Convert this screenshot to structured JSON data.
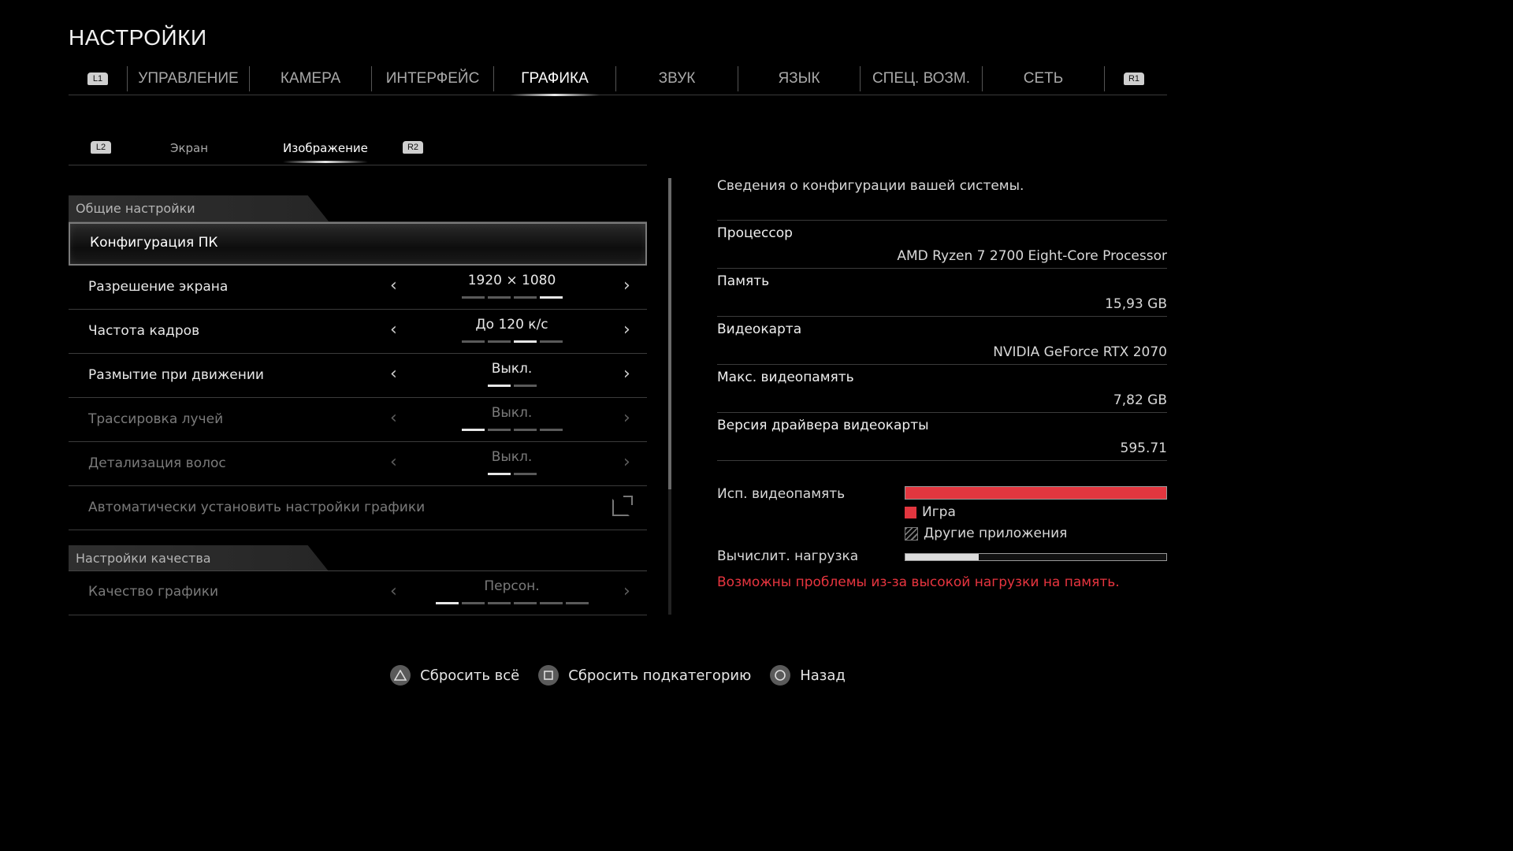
{
  "page_title": "НАСТРОЙКИ",
  "top_tabs": {
    "left_shoulder": "L1",
    "right_shoulder": "R1",
    "items": [
      {
        "label": "УПРАВЛЕНИЕ"
      },
      {
        "label": "КАМЕРА"
      },
      {
        "label": "ИНТЕРФЕЙС"
      },
      {
        "label": "ГРАФИКА",
        "active": true
      },
      {
        "label": "ЗВУК"
      },
      {
        "label": "ЯЗЫК"
      },
      {
        "label": "СПЕЦ. ВОЗМ."
      },
      {
        "label": "СЕТЬ"
      }
    ]
  },
  "sub_tabs": {
    "left_trigger": "L2",
    "right_trigger": "R2",
    "items": [
      {
        "label": "Экран"
      },
      {
        "label": "Изображение",
        "active": true
      }
    ]
  },
  "sections": {
    "general": "Общие настройки",
    "quality": "Настройки качества"
  },
  "rows": {
    "pc_config": {
      "label": "Конфигурация ПК"
    },
    "resolution": {
      "label": "Разрешение экрана",
      "value": "1920 × 1080",
      "level": 4,
      "levels": 4
    },
    "framerate": {
      "label": "Частота кадров",
      "value": "До 120 к/с",
      "level": 3,
      "levels": 4
    },
    "motion_blur": {
      "label": "Размытие при движении",
      "value": "Выкл.",
      "level": 1,
      "levels": 2
    },
    "ray_tracing": {
      "label": "Трассировка лучей",
      "value": "Выкл.",
      "level": 1,
      "levels": 4
    },
    "hair_detail": {
      "label": "Детализация волос",
      "value": "Выкл.",
      "level": 1,
      "levels": 2
    },
    "auto_settings": {
      "label": "Автоматически установить настройки графики"
    },
    "graphics_quality": {
      "label": "Качество графики",
      "value": "Персон.",
      "level": 1,
      "levels": 6
    }
  },
  "arrows": {
    "left": "‹",
    "right": "›"
  },
  "system_info": {
    "title": "Сведения о конфигурации вашей системы.",
    "items": [
      {
        "key": "Процессор",
        "value": "AMD Ryzen 7 2700 Eight-Core Processor"
      },
      {
        "key": "Память",
        "value": "15,93 GB"
      },
      {
        "key": "Видеокарта",
        "value": "NVIDIA GeForce RTX 2070"
      },
      {
        "key": "Макс. видеопамять",
        "value": "7,82 GB"
      },
      {
        "key": "Версия драйвера видеокарты",
        "value": "595.71"
      }
    ]
  },
  "vram": {
    "label": "Исп. видеопамять",
    "fill": 1.0,
    "legend_game": "Игра",
    "legend_other": "Другие приложения",
    "color": "#e2363f"
  },
  "compute_load": {
    "label": "Вычислит. нагрузка",
    "fill": 0.28
  },
  "warning": "Возможны проблемы из-за высокой нагрузки на память.",
  "footer": {
    "reset_all": "Сбросить всё",
    "reset_sub": "Сбросить подкатегорию",
    "back": "Назад"
  }
}
